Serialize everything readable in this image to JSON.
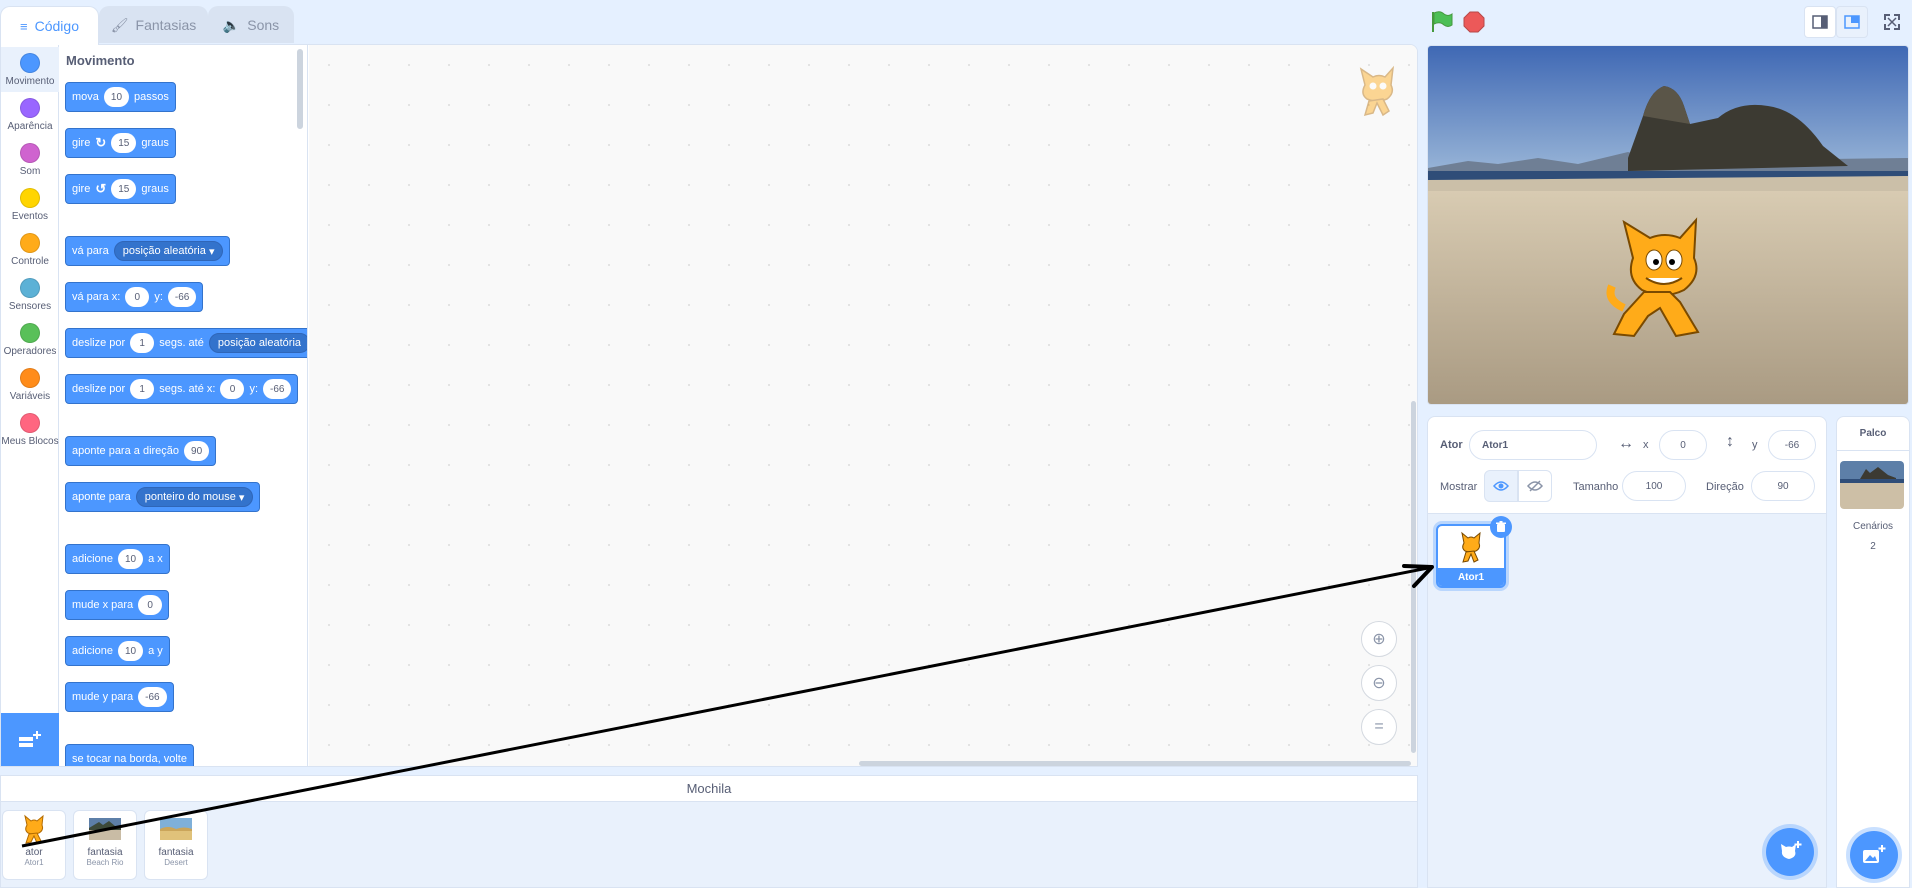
{
  "tabs": {
    "code": "Código",
    "costumes": "Fantasias",
    "sounds": "Sons"
  },
  "categories": [
    {
      "label": "Movimento",
      "color": "#4c97ff"
    },
    {
      "label": "Aparência",
      "color": "#9966ff"
    },
    {
      "label": "Som",
      "color": "#cf63cf"
    },
    {
      "label": "Eventos",
      "color": "#ffd500"
    },
    {
      "label": "Controle",
      "color": "#ffab19"
    },
    {
      "label": "Sensores",
      "color": "#5cb1d6"
    },
    {
      "label": "Operadores",
      "color": "#59c059"
    },
    {
      "label": "Variáveis",
      "color": "#ff8c1a"
    },
    {
      "label": "Meus Blocos",
      "color": "#ff6680"
    }
  ],
  "palette": {
    "title": "Movimento",
    "move": {
      "pre": "mova",
      "val": "10",
      "post": "passos"
    },
    "turn_right": {
      "pre": "gire",
      "val": "15",
      "post": "graus"
    },
    "turn_left": {
      "pre": "gire",
      "val": "15",
      "post": "graus"
    },
    "goto": {
      "pre": "vá para",
      "menu": "posição aleatória"
    },
    "goto_xy": {
      "pre": "vá para x:",
      "x": "0",
      "ylabel": "y:",
      "y": "-66"
    },
    "glide": {
      "pre": "deslize por",
      "val": "1",
      "mid": "segs. até",
      "menu": "posição aleatória"
    },
    "glide_xy": {
      "pre": "deslize por",
      "val": "1",
      "mid": "segs. até x:",
      "x": "0",
      "ylabel": "y:",
      "y": "-66"
    },
    "point_dir": {
      "pre": "aponte  para a direção",
      "val": "90"
    },
    "point_towards": {
      "pre": "aponte para",
      "menu": "ponteiro do mouse"
    },
    "change_x": {
      "pre": "adicione",
      "val": "10",
      "post": "a x"
    },
    "set_x": {
      "pre": "mude x para",
      "val": "0"
    },
    "change_y": {
      "pre": "adicione",
      "val": "10",
      "post": "a y"
    },
    "set_y": {
      "pre": "mude y para",
      "val": "-66"
    },
    "bounce": {
      "pre": "se tocar na borda, volte"
    }
  },
  "backpack": {
    "title": "Mochila",
    "items": [
      {
        "label": "ator",
        "sub": "Ator1"
      },
      {
        "label": "fantasia",
        "sub": "Beach Rio"
      },
      {
        "label": "fantasia",
        "sub": "Desert"
      }
    ]
  },
  "sprite_info": {
    "sprite_label": "Ator",
    "sprite_name": "Ator1",
    "x_label": "x",
    "x_value": "0",
    "y_label": "y",
    "y_value": "-66",
    "show_label": "Mostrar",
    "size_label": "Tamanho",
    "size_value": "100",
    "direction_label": "Direção",
    "direction_value": "90"
  },
  "sprites": [
    {
      "name": "Ator1"
    }
  ],
  "stage_pane": {
    "title": "Palco",
    "backdrops_label": "Cenários",
    "backdrops_count": "2"
  },
  "colors": {
    "accent": "#4c97ff",
    "motion_block": "#4c97ff",
    "green_flag": "#4cbf56",
    "stop": "#ec5959"
  }
}
